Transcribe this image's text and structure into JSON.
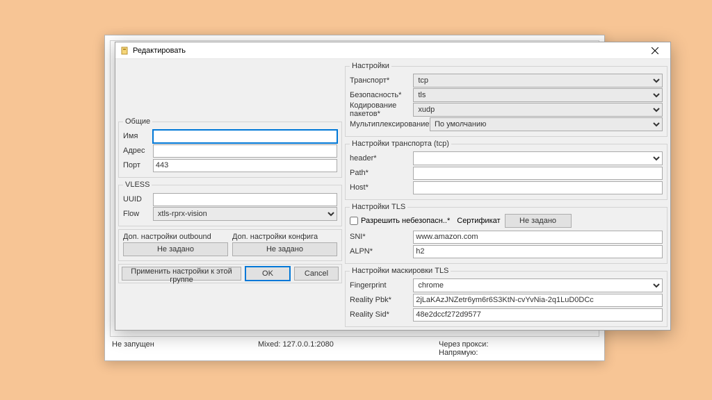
{
  "bg": {
    "status_not_running": "Не запущен",
    "status_mixed": "Mixed: 127.0.0.1:2080",
    "status_proxy": "Через прокси:",
    "status_direct": "Напрямую:"
  },
  "title": "Редактировать",
  "left": {
    "group_common": "Общие",
    "name": "Имя",
    "name_value": "",
    "address": "Адрес",
    "address_value": "",
    "port": "Порт",
    "port_value": "443",
    "group_vless": "VLESS",
    "uuid": "UUID",
    "uuid_value": "",
    "flow": "Flow",
    "flow_value": "xtls-rprx-vision",
    "extra_outbound": "Доп. настройки outbound",
    "extra_config": "Доп. настройки конфига",
    "not_set": "Не задано",
    "apply_group": "Применить настройки к этой группе",
    "ok": "OK",
    "cancel": "Cancel"
  },
  "right": {
    "group_settings": "Настройки",
    "transport": "Транспорт*",
    "transport_value": "tcp",
    "security": "Безопасность*",
    "security_value": "tls",
    "packet_encoding": "Кодирование пакетов*",
    "packet_encoding_value": "xudp",
    "mux": "Мультиплексирование*",
    "mux_value": "По умолчанию",
    "group_transport": "Настройки транспорта (tcp)",
    "header": "header*",
    "header_value": "",
    "path": "Path*",
    "path_value": "",
    "host": "Host*",
    "host_value": "",
    "group_tls": "Настройки TLS",
    "allow_insecure": "Разрешить небезопасн..*",
    "cert_label": "Сертификат",
    "cert_not_set": "Не задано",
    "sni": "SNI*",
    "sni_value": "www.amazon.com",
    "alpn": "ALPN*",
    "alpn_value": "h2",
    "group_tls_mask": "Настройки маскировки TLS",
    "fingerprint": "Fingerprint",
    "fingerprint_value": "chrome",
    "reality_pbk": "Reality Pbk*",
    "reality_pbk_value": "2jLaKAzJNZetr6ym6r6S3KtN-cvYvNia-2q1LuD0DCc",
    "reality_sid": "Reality Sid*",
    "reality_sid_value": "48e2dccf272d9577"
  }
}
